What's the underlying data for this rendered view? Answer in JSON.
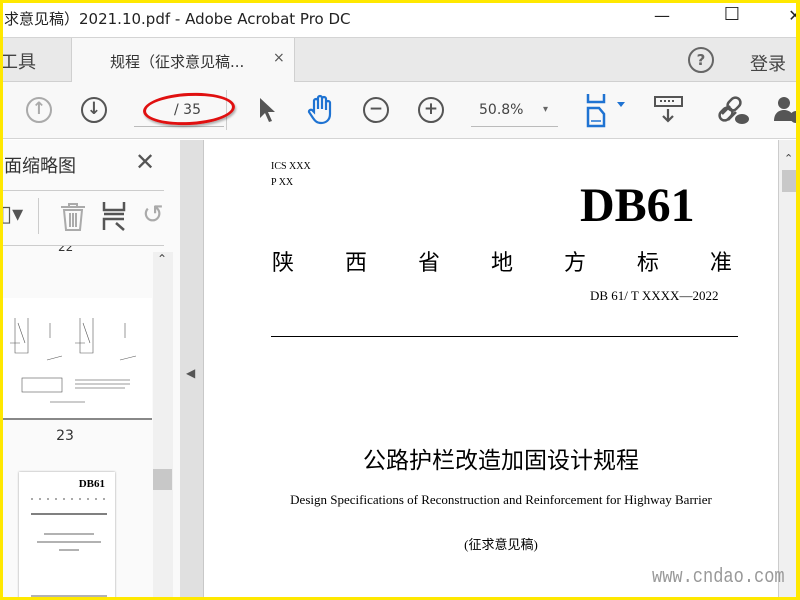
{
  "window": {
    "title": "求意见稿）2021.10.pdf - Adobe Acrobat Pro DC",
    "minimize": "—",
    "maximize": "☐",
    "close": "✕"
  },
  "tabs": {
    "tools": "工具",
    "document": "规程（征求意见稿...",
    "close": "×",
    "help": "?",
    "login": "登录"
  },
  "toolbar": {
    "page_input": "",
    "page_count": "/ 35",
    "zoom": "50.8%",
    "zoom_dropdown": "▾",
    "icons": [
      "arrow-up-circle",
      "arrow-down-circle",
      "select-pointer",
      "hand-tool",
      "zoom-out",
      "zoom-in",
      "fit-page",
      "scroll-mode",
      "link-cloud",
      "user-share"
    ]
  },
  "sidebar": {
    "title": "面缩略图",
    "close": "✕",
    "prev_page_label": "22",
    "page_label": "23",
    "thumb_heading": "DB61"
  },
  "document": {
    "ics": "ICS  XXX",
    "p": "P XX",
    "code": "DB61",
    "standard_chars": [
      "陕",
      "西",
      "省",
      "地",
      "方",
      "标",
      "准"
    ],
    "number": "DB 61/ T XXXX—2022",
    "title_cn": "公路护栏改造加固设计规程",
    "title_en": "Design Specifications of Reconstruction and Reinforcement for Highway Barrier",
    "draft": "(征求意见稿)"
  },
  "watermark": "www.cndao.com",
  "colors": {
    "accent": "#1f73d2",
    "annotation": "#e01010",
    "border": "#ffe800"
  }
}
